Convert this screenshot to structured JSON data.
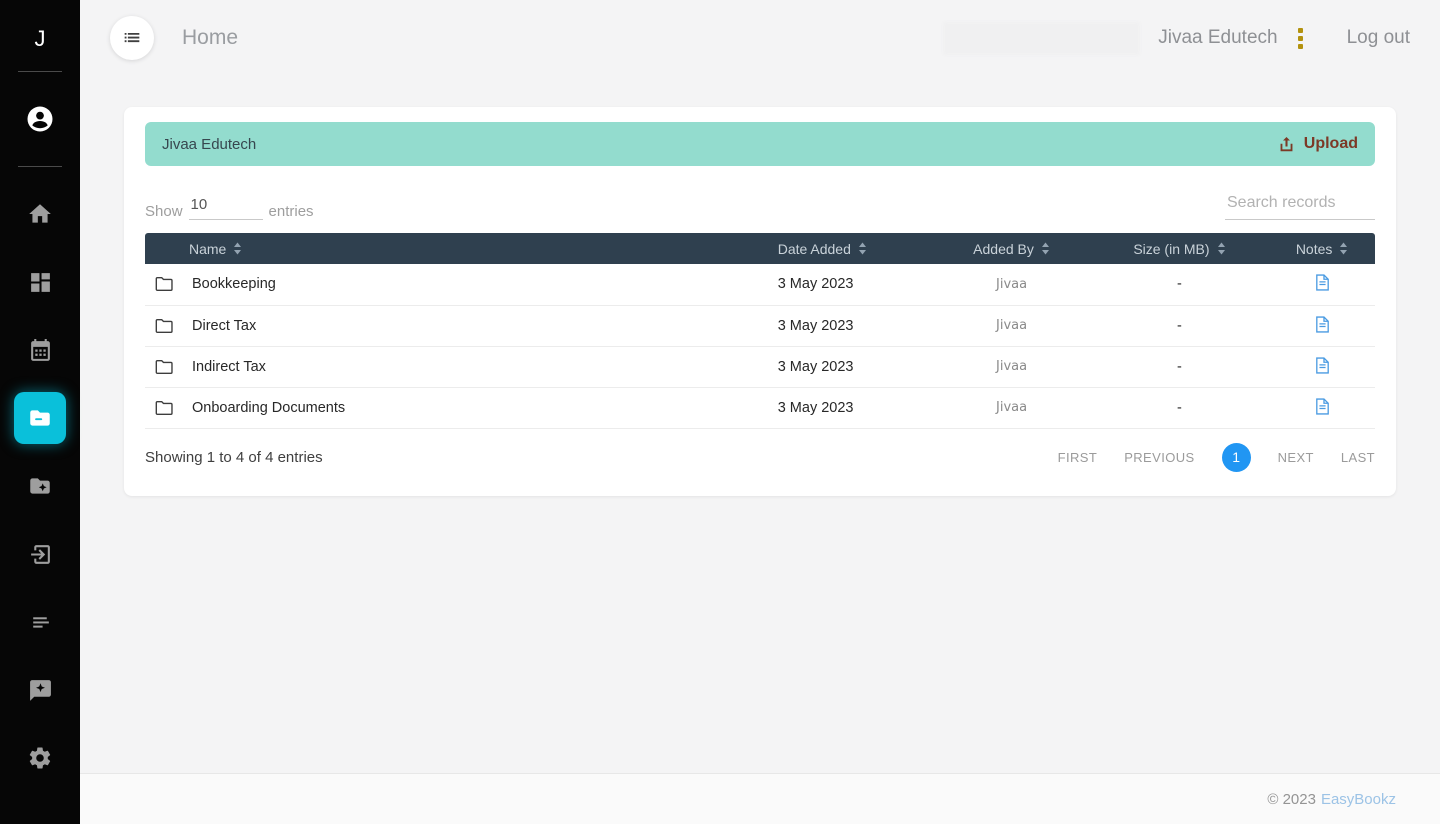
{
  "app": {
    "brand_initial": "J",
    "colors": {
      "sidebar_bg": "#060606",
      "sidebar_active": "#0ac0da",
      "panel_header_bg": "#93dcce",
      "upload_text": "#7c3926",
      "table_header_bg": "#2f404f",
      "pagination_active": "#2196f3",
      "notes_icon_blue": "#4a9be2",
      "dots_gold": "#b3920e",
      "footer_link_blue": "#9cc3e6"
    }
  },
  "sidebar": {
    "icons": [
      "account-circle-icon",
      "home-icon",
      "dashboard-icon",
      "calendar-icon",
      "documents-folder-icon",
      "folder-star-icon",
      "login-icon",
      "lines-icon",
      "message-star-icon",
      "gear-icon"
    ],
    "active_item": "documents-folder-icon"
  },
  "header": {
    "page_title": "Home",
    "account_name": "Jivaa Edutech",
    "logout_label": "Log out"
  },
  "panel": {
    "title": "Jivaa Edutech",
    "upload_label": "Upload"
  },
  "controls": {
    "show_label": "Show",
    "page_size": "10",
    "entries_label": "entries",
    "search_placeholder": "Search records"
  },
  "table": {
    "columns": [
      "Name",
      "Date Added",
      "Added By",
      "Size (in MB)",
      "Notes"
    ],
    "rows": [
      {
        "name": "Bookkeeping",
        "date_added": "3 May 2023",
        "added_by": "Jivaa",
        "size": "-"
      },
      {
        "name": "Direct Tax",
        "date_added": "3 May 2023",
        "added_by": "Jivaa",
        "size": "-"
      },
      {
        "name": "Indirect Tax",
        "date_added": "3 May 2023",
        "added_by": "Jivaa",
        "size": "-"
      },
      {
        "name": "Onboarding Documents",
        "date_added": "3 May 2023",
        "added_by": "Jivaa",
        "size": "-"
      }
    ]
  },
  "pagination": {
    "summary": "Showing 1 to 4 of 4 entries",
    "first_label": "FIRST",
    "previous_label": "PREVIOUS",
    "current_page": "1",
    "next_label": "NEXT",
    "last_label": "LAST"
  },
  "footer": {
    "copyright": "© 2023",
    "brand": "EasyBookz"
  }
}
